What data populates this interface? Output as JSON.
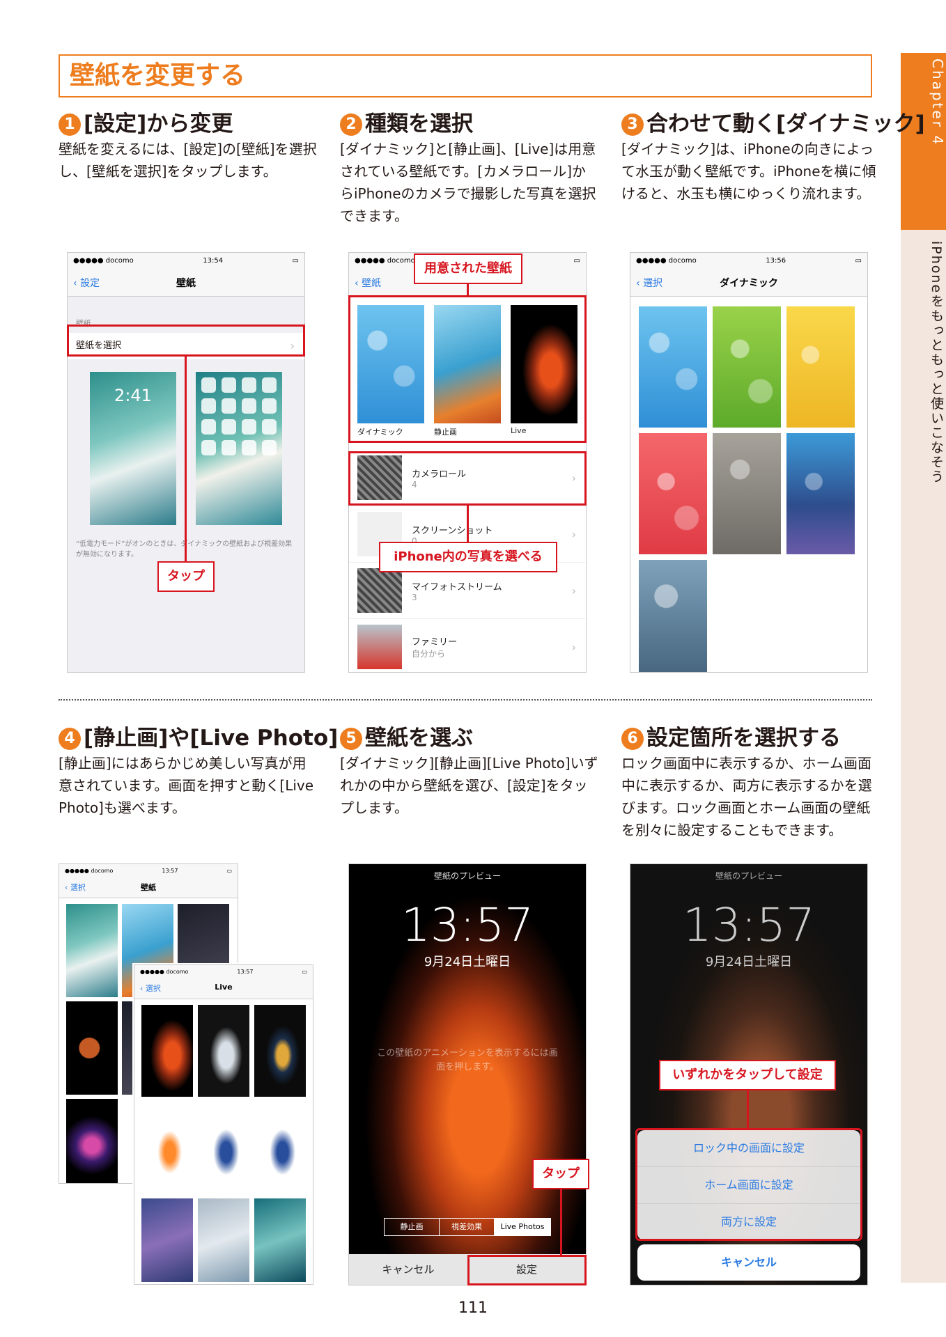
{
  "side": {
    "chapter": "Chapter 4",
    "title": "iPhoneをもっともっと使いこなそう"
  },
  "page_title": "壁紙を変更する",
  "steps": [
    {
      "num": "1",
      "title": "[設定]から変更",
      "body": "壁紙を変えるには、[設定]の[壁紙]を選択し、[壁紙を選択]をタップします。"
    },
    {
      "num": "2",
      "title": "種類を選択",
      "body": "[ダイナミック]と[静止画]、[Live]は用意されている壁紙です。[カメラロール]からiPhoneのカメラで撮影した写真を選択できます。"
    },
    {
      "num": "3",
      "title": "合わせて動く[ダイナミック]",
      "body": "[ダイナミック]は、iPhoneの向きによって水玉が動く壁紙です。iPhoneを横に傾けると、水玉も横にゆっくり流れます。"
    },
    {
      "num": "4",
      "title": "[静止画]や[Live Photo]",
      "body": "[静止画]にはあらかじめ美しい写真が用意されています。画面を押すと動く[Live Photo]も選べます。"
    },
    {
      "num": "5",
      "title": "壁紙を選ぶ",
      "body": "[ダイナミック][静止画][Live Photo]いずれかの中から壁紙を選び、[設定]をタップします。"
    },
    {
      "num": "6",
      "title": "設定箇所を選択する",
      "body": "ロック画面中に表示するか、ホーム画面中に表示するか、両方に表示するかを選びます。ロック画面とホーム画面の壁紙を別々に設定することもできます。"
    }
  ],
  "shot1": {
    "carrier": "●●●●● docomo",
    "time": "13:54",
    "back": "設定",
    "title": "壁紙",
    "section": "壁紙",
    "row": "壁紙を選択",
    "lock_time": "2:41",
    "note": "“低電力モード”がオンのときは、ダイナミックの壁紙および視差効果が無効になります。",
    "callout": "タップ"
  },
  "shot2": {
    "carrier": "●●●●● docomo",
    "back": "壁紙",
    "callout_top": "用意された壁紙",
    "cat1": "ダイナミック",
    "cat2": "静止画",
    "cat3": "Live",
    "albums": [
      {
        "name": "カメラロール",
        "count": "4"
      },
      {
        "name": "スクリーンショット",
        "count": "0"
      },
      {
        "name": "マイフォトストリーム",
        "count": "3"
      },
      {
        "name": "ファミリー",
        "count": "自分から"
      }
    ],
    "callout_mid": "iPhone内の写真を選べる"
  },
  "shot3": {
    "carrier": "●●●●● docomo",
    "time": "13:56",
    "back": "選択",
    "title": "ダイナミック"
  },
  "shot4": {
    "carrier": "●●●●● docomo",
    "time": "13:57",
    "back": "選択",
    "title": "壁紙",
    "inner_carrier": "●●●●● docomo",
    "inner_time": "13:57",
    "inner_back": "選択",
    "inner_title": "Live"
  },
  "shot5": {
    "header": "壁紙のプレビュー",
    "clock": "13:57",
    "date": "9月24日土曜日",
    "hint": "この壁紙のアニメーションを表示するには画面を押します。",
    "seg1": "静止画",
    "seg2": "視差効果",
    "seg3": "Live Photos",
    "cancel": "キャンセル",
    "set": "設定",
    "callout": "タップ"
  },
  "shot6": {
    "header": "壁紙のプレビュー",
    "clock": "13:57",
    "date": "9月24日土曜日",
    "callout": "いずれかをタップして設定",
    "opt1": "ロック中の画面に設定",
    "opt2": "ホーム画面に設定",
    "opt3": "両方に設定",
    "cancel": "キャンセル"
  },
  "page_number": "111",
  "colors": {
    "accent": "#ee7d1f",
    "callout_red": "#d7151f",
    "side_bg": "#f3e6de"
  }
}
